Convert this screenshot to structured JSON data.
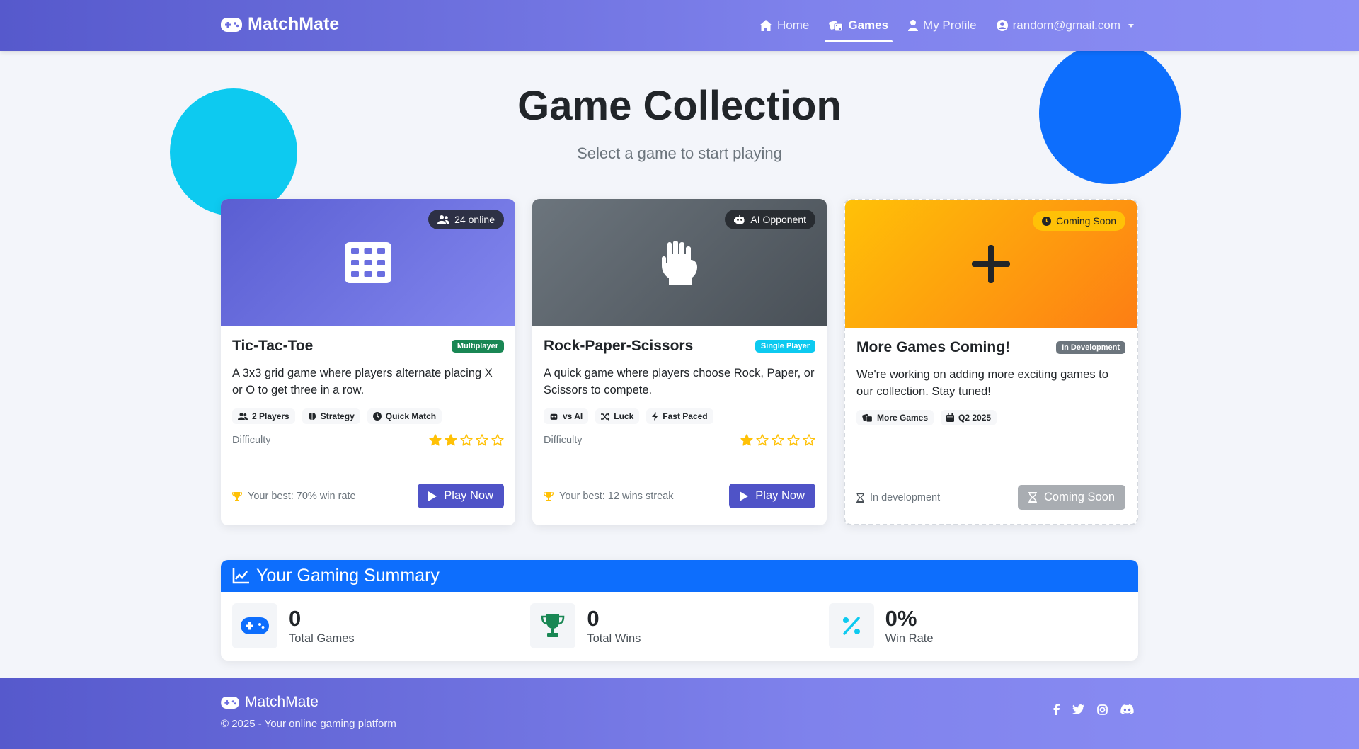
{
  "nav": {
    "brand": "MatchMate",
    "links": [
      {
        "label": "Home",
        "icon": "home-icon"
      },
      {
        "label": "Games",
        "icon": "dice-icon",
        "active": true
      },
      {
        "label": "My Profile",
        "icon": "user-icon"
      }
    ],
    "user_email": "random@gmail.com"
  },
  "header": {
    "title": "Game Collection",
    "subtitle": "Select a game to start playing"
  },
  "games": [
    {
      "title": "Tic-Tac-Toe",
      "image_badge": "24 online",
      "type_badge": "Multiplayer",
      "description": "A 3x3 grid game where players alternate placing X or O to get three in a row.",
      "tags": [
        "2 Players",
        "Strategy",
        "Quick Match"
      ],
      "difficulty_label": "Difficulty",
      "difficulty_stars": 2,
      "difficulty_max": 5,
      "best": "Your best: 70% win rate",
      "button": "Play Now"
    },
    {
      "title": "Rock-Paper-Scissors",
      "image_badge": "AI Opponent",
      "type_badge": "Single Player",
      "description": "A quick game where players choose Rock, Paper, or Scissors to compete.",
      "tags": [
        "vs AI",
        "Luck",
        "Fast Paced"
      ],
      "difficulty_label": "Difficulty",
      "difficulty_stars": 1,
      "difficulty_max": 5,
      "best": "Your best: 12 wins streak",
      "button": "Play Now"
    },
    {
      "title": "More Games Coming!",
      "image_badge": "Coming Soon",
      "type_badge": "In Development",
      "description": "We're working on adding more exciting games to our collection. Stay tuned!",
      "tags": [
        "More Games",
        "Q2 2025"
      ],
      "status": "In development",
      "button": "Coming Soon"
    }
  ],
  "summary": {
    "title": "Your Gaming Summary",
    "stats": [
      {
        "value": "0",
        "label": "Total Games",
        "icon": "gamepad-icon"
      },
      {
        "value": "0",
        "label": "Total Wins",
        "icon": "trophy-icon"
      },
      {
        "value": "0%",
        "label": "Win Rate",
        "icon": "percent-icon"
      }
    ]
  },
  "footer": {
    "brand": "MatchMate",
    "copyright": "© 2025 - Your online gaming platform",
    "socials": [
      "facebook-icon",
      "twitter-icon",
      "instagram-icon",
      "discord-icon"
    ]
  },
  "colors": {
    "primary_gradient_start": "#5659cc",
    "primary_gradient_end": "#8c8ff5",
    "play_button": "#4f53c7",
    "summary_header": "#0d6efd",
    "star": "#ffc107",
    "circle_cyan": "#0dcaf0",
    "circle_blue": "#0d6efd"
  }
}
